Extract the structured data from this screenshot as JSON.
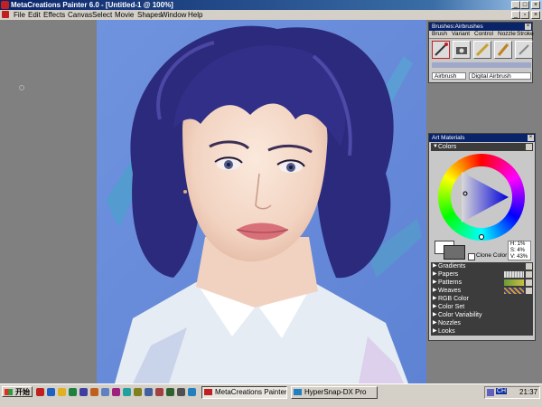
{
  "window": {
    "title": "MetaCreations Painter 6.0 - [Untitled-1 @ 100%]"
  },
  "menu": [
    {
      "label": "File"
    },
    {
      "label": "Edit"
    },
    {
      "label": "Effects"
    },
    {
      "label": "Canvas"
    },
    {
      "label": "Select"
    },
    {
      "label": "Movie"
    },
    {
      "label": "Shapes"
    },
    {
      "label": "Window"
    },
    {
      "label": "Help"
    }
  ],
  "brushes_palette": {
    "title": "Brushes:Airbrushes",
    "tabs": [
      "Brush",
      "Variant",
      "Control",
      "Nozzle",
      "Stroke"
    ],
    "brush_field": "Airbrush",
    "variant_field": "Digital Airbrush"
  },
  "art_materials": {
    "title": "Art Materials",
    "colors_label": "Colors",
    "hsv": {
      "h": "H: 1%",
      "s": "S: 4%",
      "v": "V: 43%"
    },
    "clone_color_label": "Clone Color",
    "sections": [
      {
        "label": "Gradients"
      },
      {
        "label": "Papers"
      },
      {
        "label": "Patterns"
      },
      {
        "label": "Weaves"
      },
      {
        "label": "RGB Color"
      },
      {
        "label": "Color Set"
      },
      {
        "label": "Color Variability"
      },
      {
        "label": "Nozzles"
      },
      {
        "label": "Looks"
      }
    ]
  },
  "taskbar": {
    "start_label": "开始",
    "tasks": [
      {
        "label": "MetaCreations Painter 6....",
        "active": true
      },
      {
        "label": "HyperSnap-DX Pro",
        "active": false
      }
    ],
    "tray_lang": "CH",
    "clock": "21:37"
  },
  "colors": {
    "accent_titlebar": "#0a246a",
    "canvas_blue": "#6b8fd9",
    "hair": "#2e2d7f"
  }
}
